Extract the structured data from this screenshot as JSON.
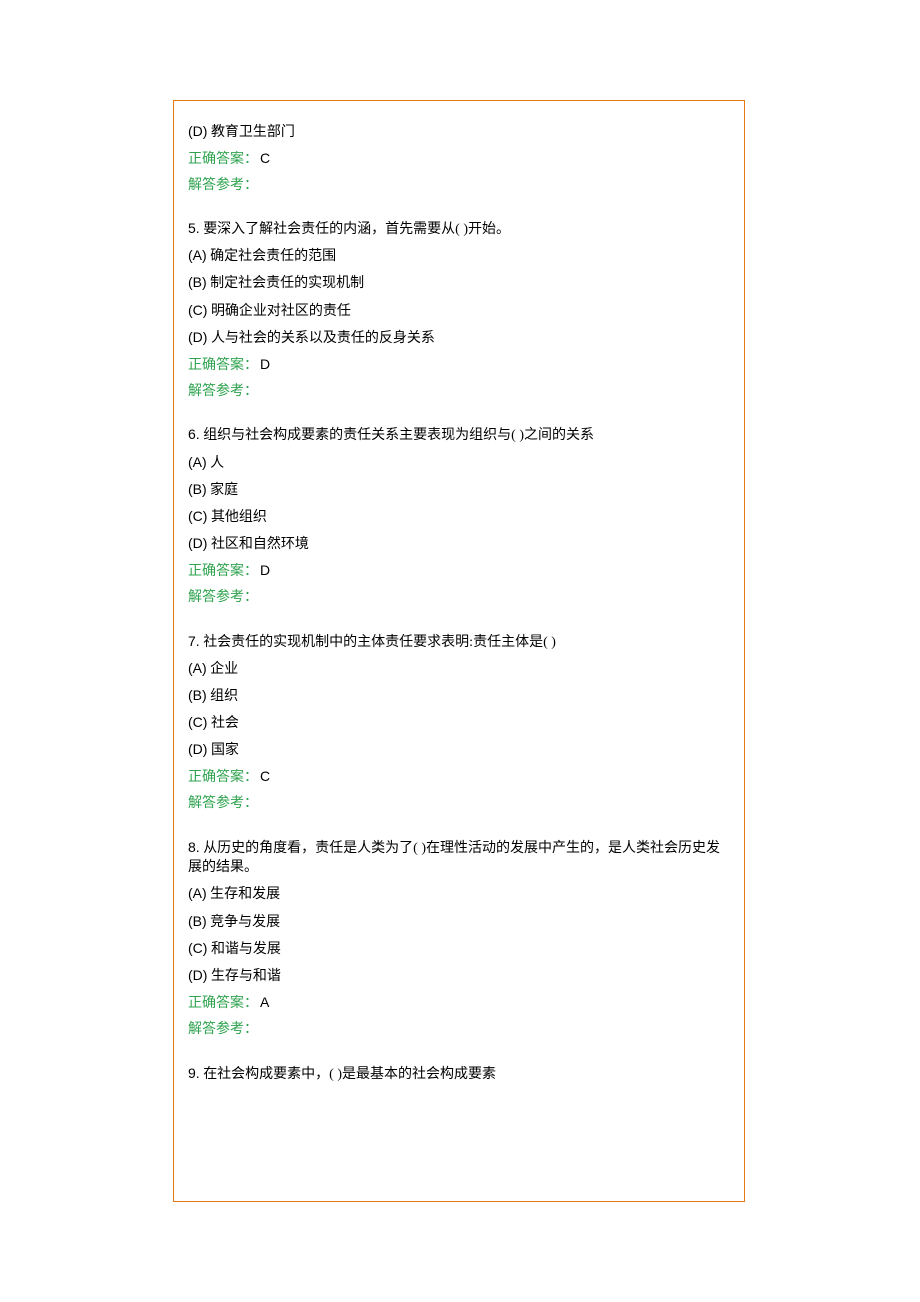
{
  "q4_tail": {
    "optD_label": "(D)",
    "optD_text": " 教育卫生部门",
    "answer_prefix": "正确答案：",
    "answer_letter": "C",
    "ref": "解答参考："
  },
  "q5": {
    "num": "5.",
    "stem": " 要深入了解社会责任的内涵，首先需要从(  )开始。",
    "opts": [
      {
        "label": "(A)",
        "text": " 确定社会责任的范围"
      },
      {
        "label": "(B)",
        "text": " 制定社会责任的实现机制"
      },
      {
        "label": "(C)",
        "text": " 明确企业对社区的责任"
      },
      {
        "label": "(D)",
        "text": " 人与社会的关系以及责任的反身关系"
      }
    ],
    "answer_prefix": "正确答案：",
    "answer_letter": "D",
    "ref": "解答参考："
  },
  "q6": {
    "num": "6.",
    "stem": " 组织与社会构成要素的责任关系主要表现为组织与(  )之间的关系",
    "opts": [
      {
        "label": "(A)",
        "text": " 人"
      },
      {
        "label": "(B)",
        "text": " 家庭"
      },
      {
        "label": "(C)",
        "text": " 其他组织"
      },
      {
        "label": "(D)",
        "text": " 社区和自然环境"
      }
    ],
    "answer_prefix": "正确答案：",
    "answer_letter": "D",
    "ref": "解答参考："
  },
  "q7": {
    "num": "7.",
    "stem": " 社会责任的实现机制中的主体责任要求表明:责任主体是(  )",
    "opts": [
      {
        "label": "(A)",
        "text": " 企业"
      },
      {
        "label": "(B)",
        "text": " 组织"
      },
      {
        "label": "(C)",
        "text": " 社会"
      },
      {
        "label": "(D)",
        "text": " 国家"
      }
    ],
    "answer_prefix": "正确答案：",
    "answer_letter": "C",
    "ref": "解答参考："
  },
  "q8": {
    "num": "8.",
    "stem": " 从历史的角度看，责任是人类为了(  )在理性活动的发展中产生的，是人类社会历史发展的结果。",
    "opts": [
      {
        "label": "(A)",
        "text": " 生存和发展"
      },
      {
        "label": "(B)",
        "text": " 竞争与发展"
      },
      {
        "label": "(C)",
        "text": " 和谐与发展"
      },
      {
        "label": "(D)",
        "text": " 生存与和谐"
      }
    ],
    "answer_prefix": "正确答案：",
    "answer_letter": "A",
    "ref": "解答参考："
  },
  "q9": {
    "num": "9.",
    "stem": " 在社会构成要素中，(  )是最基本的社会构成要素"
  }
}
